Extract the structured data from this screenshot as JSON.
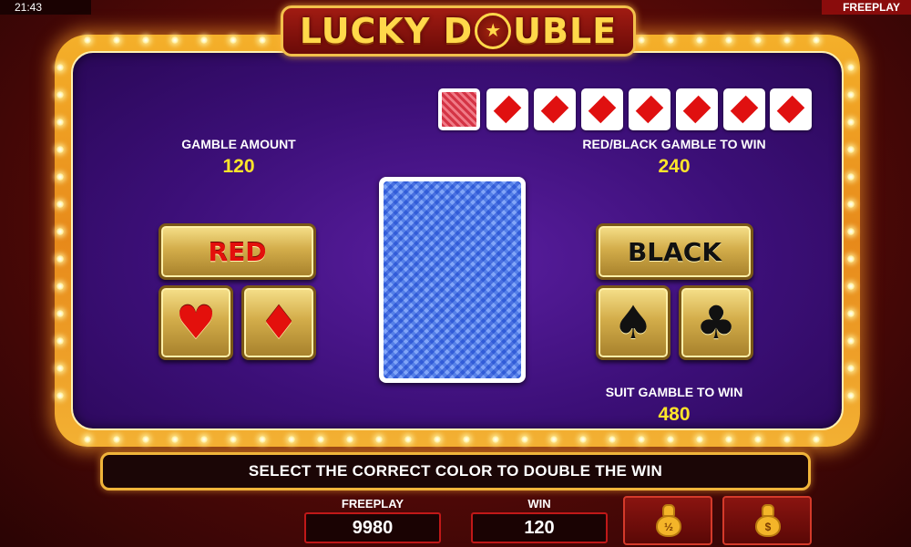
{
  "status": {
    "time": "21:43",
    "mode": "FREEPLAY"
  },
  "logo": {
    "part1": "LUCKY D",
    "part2": "UBLE",
    "star": "★"
  },
  "history": [
    {
      "type": "back"
    },
    {
      "type": "diamond"
    },
    {
      "type": "diamond"
    },
    {
      "type": "diamond"
    },
    {
      "type": "diamond"
    },
    {
      "type": "diamond"
    },
    {
      "type": "diamond"
    },
    {
      "type": "diamond"
    }
  ],
  "gamble": {
    "amount_label": "GAMBLE AMOUNT",
    "amount_value": "120",
    "redblack_label": "RED/BLACK GAMBLE TO WIN",
    "redblack_value": "240",
    "suit_label": "SUIT GAMBLE TO WIN",
    "suit_value": "480"
  },
  "buttons": {
    "red": "RED",
    "black": "BLACK",
    "heart": "♥",
    "diamond": "♦",
    "spade": "♠",
    "club": "♣"
  },
  "message": "SELECT THE CORRECT COLOR TO DOUBLE THE WIN",
  "footer": {
    "freeplay_label": "FREEPLAY",
    "freeplay_value": "9980",
    "win_label": "WIN",
    "win_value": "120",
    "half_collect": "½",
    "full_collect": "$"
  },
  "colors": {
    "red_suit": "#e3100c",
    "black_suit": "#111111",
    "value_yellow": "#ffe52a"
  }
}
